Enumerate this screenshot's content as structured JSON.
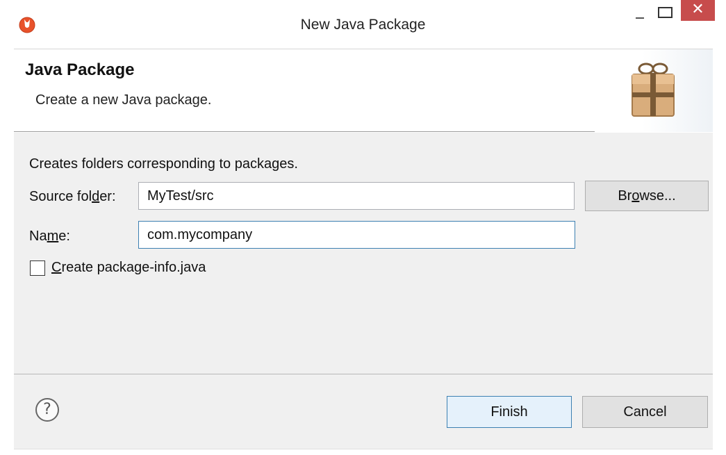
{
  "window": {
    "title": "New Java Package",
    "close_glyph": "✕",
    "icons": [
      "eclipse-app-icon",
      "minimize-icon",
      "maximize-icon",
      "close-icon"
    ]
  },
  "banner": {
    "title": "Java Package",
    "description": "Create a new Java package.",
    "icon": "package-icon"
  },
  "body": {
    "intro": "Creates folders corresponding to packages.",
    "source_folder": {
      "label_before": "Source fol",
      "label_mnemonic": "d",
      "label_after": "er:",
      "value": "MyTest/src"
    },
    "browse_button": {
      "label_before": "Br",
      "label_mnemonic": "o",
      "label_after": "wse..."
    },
    "name": {
      "label_before": "Na",
      "label_mnemonic": "m",
      "label_after": "e:",
      "value": "com.mycompany"
    },
    "create_package_info": {
      "label_mnemonic": "C",
      "label_after": "reate package-info.java",
      "checked": false
    }
  },
  "footer": {
    "help_glyph": "?",
    "finish_label": "Finish",
    "cancel_label": "Cancel"
  },
  "colors": {
    "close_button": "#c74c4c",
    "focus_border": "#3c7fb1",
    "dialog_background": "#f0f0f0"
  }
}
